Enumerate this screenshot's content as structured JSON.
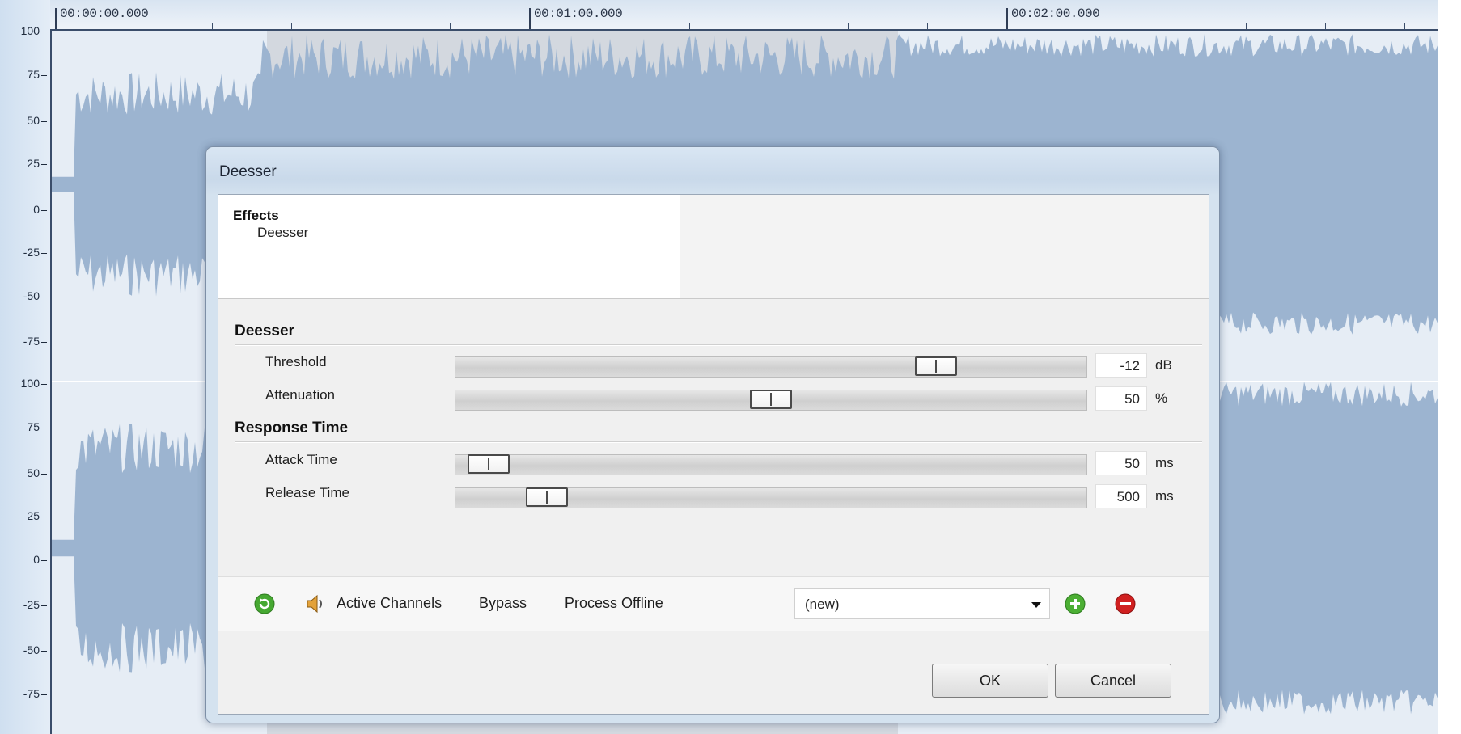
{
  "timeline": {
    "time_labels": [
      "00:00:00.000",
      "00:01:00.000",
      "00:02:00.000"
    ],
    "amplitude_ticks": [
      "100",
      "75",
      "50",
      "25",
      "0",
      "-25",
      "-50",
      "-75",
      "100",
      "75",
      "50",
      "25",
      "0",
      "-25",
      "-50",
      "-75"
    ]
  },
  "dialog": {
    "title": "Deesser",
    "tree": {
      "root": "Effects",
      "child": "Deesser"
    },
    "sections": {
      "deesser": "Deesser",
      "response_time": "Response Time"
    },
    "params": {
      "threshold": {
        "label": "Threshold",
        "value": "-12",
        "unit": "dB",
        "level": 0.78
      },
      "attenuation": {
        "label": "Attenuation",
        "value": "50",
        "unit": "%",
        "level": 0.5
      },
      "attack_time": {
        "label": "Attack Time",
        "value": "50",
        "unit": "ms",
        "level": 0.02
      },
      "release_time": {
        "label": "Release Time",
        "value": "500",
        "unit": "ms",
        "level": 0.12
      }
    },
    "toolbar": {
      "active_channels": "Active Channels",
      "bypass": "Bypass",
      "process_offline": "Process Offline",
      "preset_value": "(new)"
    },
    "buttons": {
      "ok": "OK",
      "cancel": "Cancel"
    }
  },
  "colors": {
    "waveform": "#9cb4d0",
    "waveform_highlight": "#8aa8cb",
    "add_preset": "#4caf34",
    "delete_preset": "#d02020"
  },
  "icons": {
    "reset": "reset-icon",
    "channels": "speaker-icon",
    "add": "add-preset-icon",
    "delete": "delete-preset-icon",
    "dropdown": "chevron-down-icon"
  }
}
